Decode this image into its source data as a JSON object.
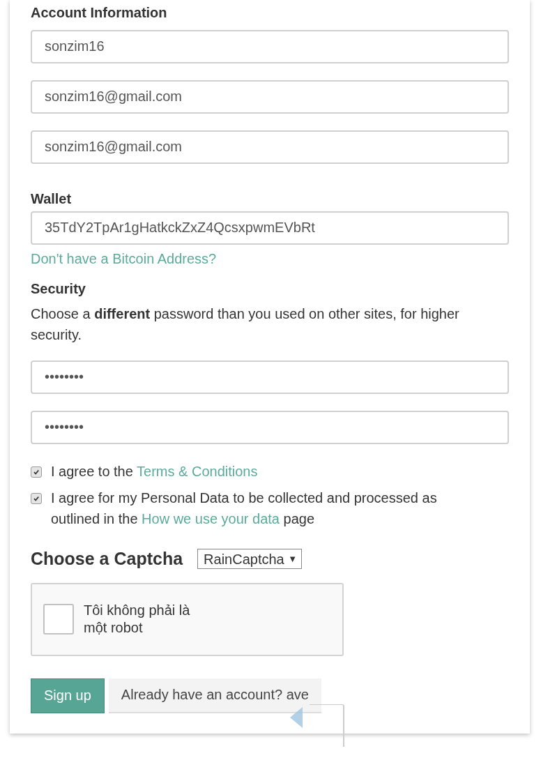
{
  "account": {
    "heading": "Account Information",
    "fields": [
      {
        "value": "sonzim16"
      },
      {
        "value": "sonzim16@gmail.com"
      },
      {
        "value": "sonzim16@gmail.com"
      }
    ]
  },
  "wallet": {
    "heading": "Wallet",
    "field": {
      "value": "35TdY2TpAr1gHatkckZxZ4QcsxpwmEVbRt"
    },
    "link": "Don't have a Bitcoin Address?"
  },
  "security": {
    "heading": "Security",
    "hint": "Choose a **different** password than you used on other sites, for higher security.",
    "fields": [
      {
        "value": "••••••••"
      },
      {
        "value": "••••••••"
      }
    ]
  },
  "agreements": [
    {
      "checked": true,
      "parts": [
        {
          "kind": "text",
          "text": "I agree to the "
        },
        {
          "kind": "link",
          "text": "Terms & Conditions"
        }
      ]
    },
    {
      "checked": true,
      "parts": [
        {
          "kind": "text",
          "text": "I agree for my Personal Data to be collected and processed as outlined in the "
        },
        {
          "kind": "link",
          "text": "How we use your data"
        },
        {
          "kind": "text",
          "text": " page"
        }
      ]
    }
  ],
  "captcha": {
    "heading": "Choose a Captcha",
    "select": {
      "value": "RainCaptcha",
      "caret": "▼"
    },
    "checked": false,
    "label": "Tôi không phải là một robot"
  },
  "buttons": [
    {
      "kind": "primary",
      "label": "Sign up"
    },
    {
      "kind": "secondary",
      "label": "Already have an account? ave"
    }
  ]
}
